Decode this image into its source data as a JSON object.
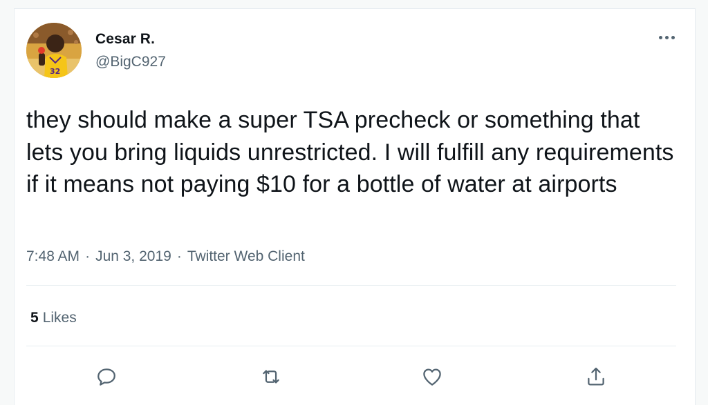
{
  "author": {
    "name": "Cesar R.",
    "handle": "@BigC927",
    "avatar_icon": "lakers-player-avatar"
  },
  "tweet": {
    "text": "they should make a super TSA precheck or something that lets you bring liquids unrestricted. I will fulfill any requirements if it means not paying $10 for a bottle of water at airports",
    "time": "7:48 AM",
    "date": "Jun 3, 2019",
    "client": "Twitter Web Client",
    "separator": "·"
  },
  "stats": {
    "likes_count": "5",
    "likes_label": "Likes"
  },
  "actions": {
    "reply_icon": "reply-icon",
    "retweet_icon": "retweet-icon",
    "like_icon": "heart-icon",
    "share_icon": "share-icon"
  },
  "colors": {
    "text_primary": "#0f1419",
    "text_secondary": "#536471",
    "divider": "#e6ecf0",
    "icon": "#536471"
  }
}
